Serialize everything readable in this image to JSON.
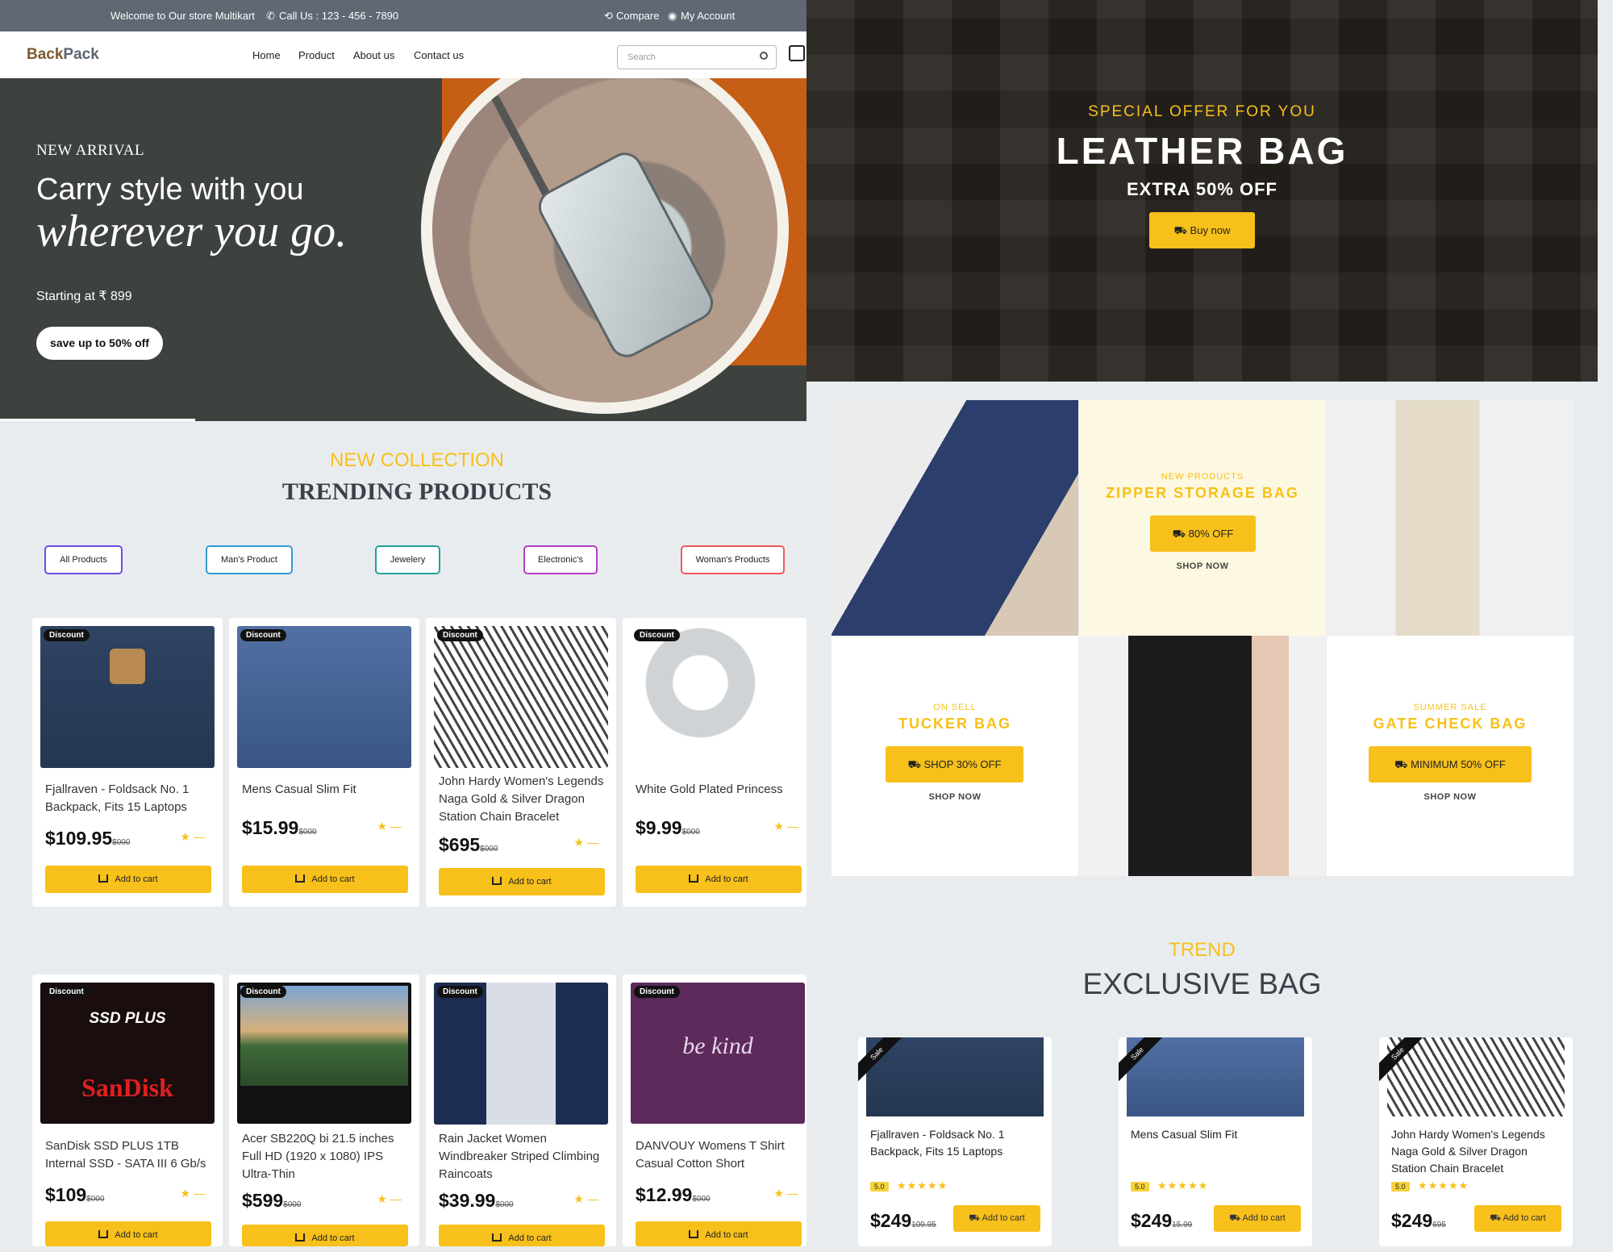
{
  "topbar": {
    "welcome": "Welcome to Our store Multikart",
    "phone": "Call Us : 123 - 456 - 7890",
    "compare": "Compare",
    "account": "My Account"
  },
  "navbar": {
    "logo_a": "Back",
    "logo_b": "Pack",
    "links": [
      "Home",
      "Product",
      "About us",
      "Contact us"
    ],
    "search_placeholder": "Search"
  },
  "hero": {
    "kicker": "NEW ARRIVAL",
    "line1": "Carry style with you",
    "line2": "wherever you go.",
    "price": "Starting at ₹ 899",
    "button": "save up to 50% off"
  },
  "trending": {
    "kicker": "NEW COLLECTION",
    "title": "TRENDING PRODUCTS",
    "filters": [
      "All Products",
      "Man's Product",
      "Jewelery",
      "Electronic's",
      "Woman's Products"
    ],
    "badge": "Discount",
    "add_to_cart": "Add to cart",
    "products": [
      {
        "name": "Fjallraven - Foldsack No. 1 Backpack, Fits 15 Laptops",
        "price": "$109.95",
        "old": "$000"
      },
      {
        "name": "Mens Casual Slim Fit",
        "price": "$15.99",
        "old": "$000"
      },
      {
        "name": "John Hardy Women's Legends Naga Gold & Silver Dragon Station Chain Bracelet",
        "price": "$695",
        "old": "$000"
      },
      {
        "name": "White Gold Plated Princess",
        "price": "$9.99",
        "old": "$000"
      },
      {
        "name": "SanDisk SSD PLUS 1TB Internal SSD - SATA III 6 Gb/s",
        "price": "$109",
        "old": "$000"
      },
      {
        "name": "Acer SB220Q bi 21.5 inches Full HD (1920 x 1080) IPS Ultra-Thin",
        "price": "$599",
        "old": "$000"
      },
      {
        "name": "Rain Jacket Women Windbreaker Striped Climbing Raincoats",
        "price": "$39.99",
        "old": "$000"
      },
      {
        "name": "DANVOUY Womens T Shirt Casual Cotton Short",
        "price": "$12.99",
        "old": "$000"
      }
    ]
  },
  "banner": {
    "kicker": "SPECIAL OFFER FOR YOU",
    "title": "LEATHER BAG",
    "subtitle": "EXTRA 50% OFF",
    "button": "Buy now"
  },
  "promo": {
    "zipper": {
      "kicker": "NEW PRODUCTS",
      "title": "ZIPPER STORAGE BAG",
      "button": "80% OFF",
      "shop": "SHOP NOW"
    },
    "tucker": {
      "kicker": "ON SELL",
      "title": "TUCKER BAG",
      "button": "SHOP 30% OFF",
      "shop": "SHOP NOW"
    },
    "gate": {
      "kicker": "SUMMER SALE",
      "title": "GATE CHECK BAG",
      "button": "MINIMUM 50% OFF",
      "shop": "SHOP NOW"
    }
  },
  "exclusive": {
    "kicker": "TREND",
    "title": "EXCLUSIVE BAG",
    "ribbon": "Sale",
    "add_to_cart": "Add to cart",
    "items": [
      {
        "name": "Fjallraven - Foldsack No. 1 Backpack, Fits 15 Laptops",
        "rating": "5.0",
        "price": "$249",
        "old": "109.95"
      },
      {
        "name": "Mens Casual Slim Fit",
        "rating": "5.0",
        "price": "$249",
        "old": "15.99"
      },
      {
        "name": "John Hardy Women's Legends Naga Gold & Silver Dragon Station Chain Bracelet",
        "rating": "5.0",
        "price": "$249",
        "old": "695"
      }
    ]
  },
  "colors": {
    "accent": "#f7c01a",
    "hero_bg": "#3e423f",
    "hero_orange": "#c65e16",
    "topbar": "#5f6873"
  },
  "icons": [
    "phone-icon",
    "compare-icon",
    "account-icon",
    "search-icon",
    "cart-icon",
    "star-icon"
  ]
}
